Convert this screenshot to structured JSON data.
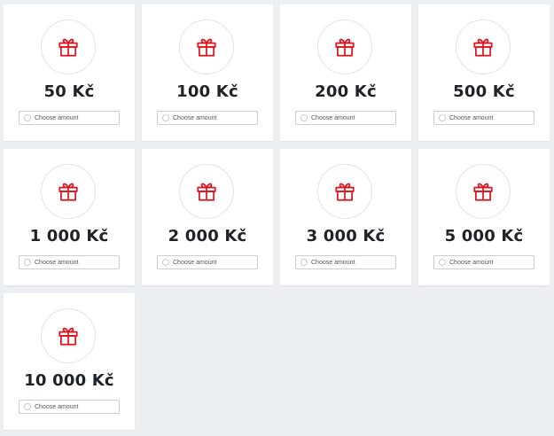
{
  "colors": {
    "accent": "#e0141e",
    "background": "#edf0f3",
    "card": "#ffffff",
    "amount_text": "#1f2328"
  },
  "icon": "gift-icon",
  "choose_label": "Choose amount",
  "vouchers": [
    {
      "amount": "50 Kč"
    },
    {
      "amount": "100 Kč"
    },
    {
      "amount": "200 Kč"
    },
    {
      "amount": "500 Kč"
    },
    {
      "amount": "1 000 Kč"
    },
    {
      "amount": "2 000 Kč"
    },
    {
      "amount": "3 000 Kč"
    },
    {
      "amount": "5 000 Kč"
    },
    {
      "amount": "10 000 Kč"
    }
  ]
}
